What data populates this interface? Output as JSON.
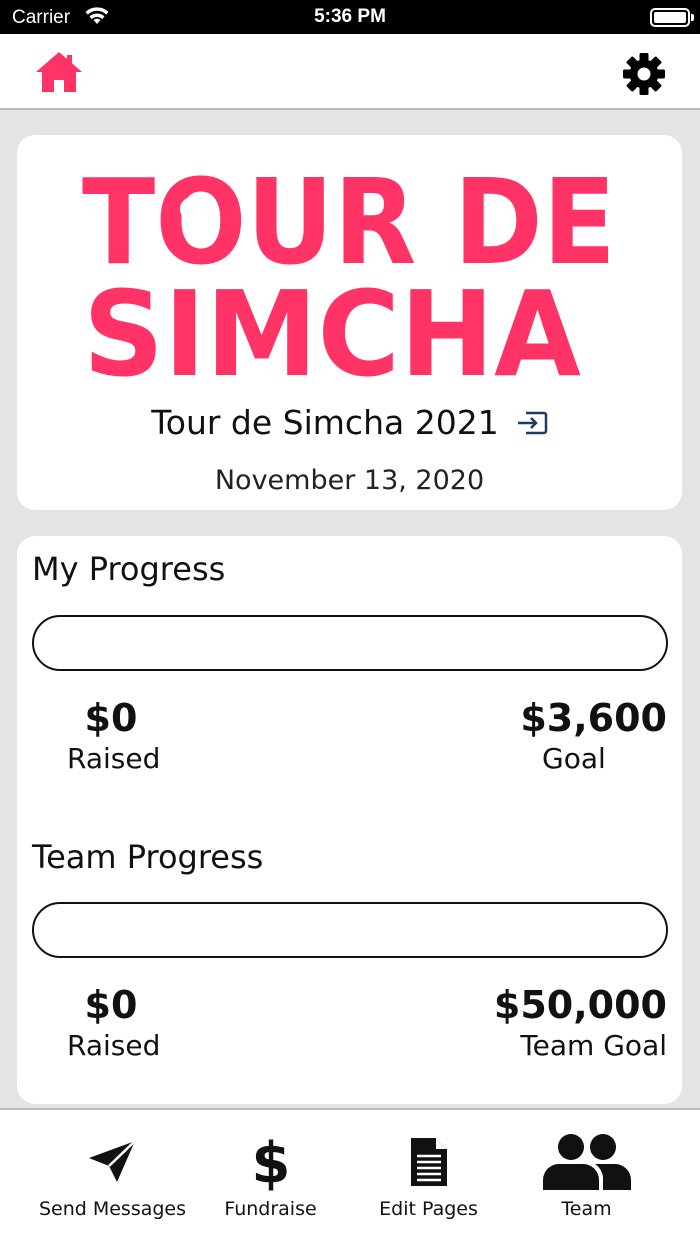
{
  "status_bar": {
    "carrier": "Carrier",
    "time": "5:36 PM"
  },
  "colors": {
    "brand": "#ff3366",
    "background": "#e3e4e3",
    "card": "#ffffff",
    "text": "#111111"
  },
  "nav": {
    "home_icon": "home-icon",
    "settings_icon": "gear-icon"
  },
  "event": {
    "logo_line1": "TOUR DE",
    "logo_line2": "SIMCHA",
    "title": "Tour de Simcha 2021",
    "date": "November 13, 2020"
  },
  "my_progress": {
    "title": "My Progress",
    "raised_amount": "$0",
    "raised_label": "Raised",
    "goal_amount": "$3,600",
    "goal_label": "Goal",
    "fraction": 0
  },
  "team_progress": {
    "title": "Team Progress",
    "raised_amount": "$0",
    "raised_label": "Raised",
    "goal_amount": "$50,000",
    "goal_label": "Team Goal",
    "fraction": 0
  },
  "tabs": [
    {
      "label": "Send Messages",
      "icon": "paper-plane-icon"
    },
    {
      "label": "Fundraise",
      "icon": "dollar-icon"
    },
    {
      "label": "Edit Pages",
      "icon": "document-icon"
    },
    {
      "label": "Team",
      "icon": "team-icon"
    }
  ]
}
